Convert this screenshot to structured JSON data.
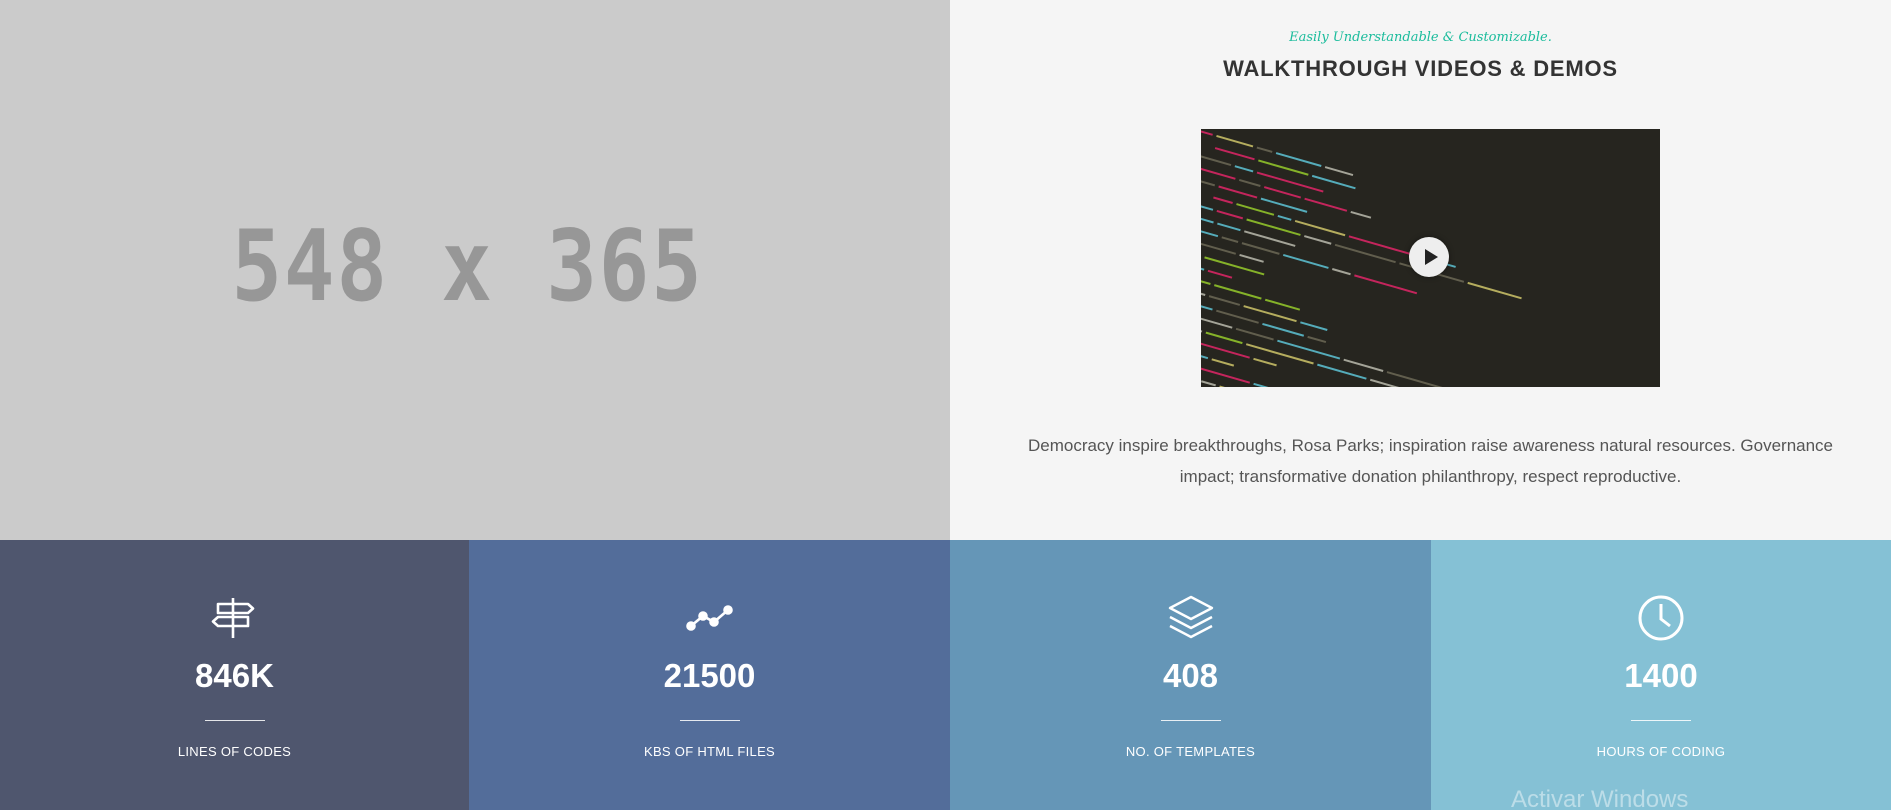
{
  "placeholder": {
    "text": "548 x 365"
  },
  "promo": {
    "subtitle": "Easily Understandable & Customizable.",
    "title": "WALKTHROUGH VIDEOS & DEMOS",
    "description": "Democracy inspire breakthroughs, Rosa Parks; inspiration raise awareness natural resources. Governance impact; transformative donation philanthropy, respect reproductive."
  },
  "stats": [
    {
      "value": "846K",
      "label": "LINES OF CODES",
      "icon": "signpost-icon",
      "color": "#4f566e"
    },
    {
      "value": "21500",
      "label": "KBS OF HTML FILES",
      "icon": "chart-line-icon",
      "color": "#536d9a"
    },
    {
      "value": "408",
      "label": "NO. OF TEMPLATES",
      "icon": "layers-icon",
      "color": "#6596b7"
    },
    {
      "value": "1400",
      "label": "HOURS OF CODING",
      "icon": "clock-icon",
      "color": "#85c1d5"
    }
  ],
  "watermark": "Activar Windows"
}
